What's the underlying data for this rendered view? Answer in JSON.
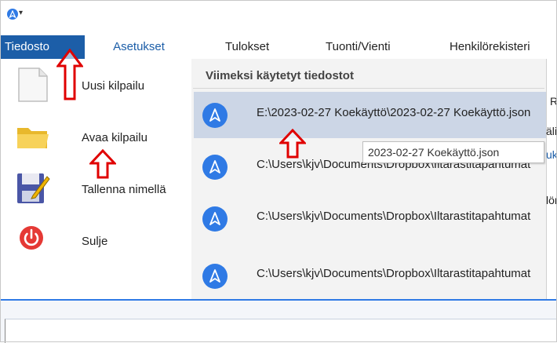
{
  "ribbon": {
    "tabs": [
      {
        "label": "Tiedosto",
        "active": true
      },
      {
        "label": "Asetukset"
      },
      {
        "label": "Tulokset"
      },
      {
        "label": "Tuonti/Vienti"
      },
      {
        "label": "Henkilörekisteri"
      }
    ]
  },
  "backstage": {
    "commands": [
      {
        "label": "Uusi kilpailu",
        "icon": "new-document-icon"
      },
      {
        "label": "Avaa kilpailu",
        "icon": "folder-icon"
      },
      {
        "label": "Tallenna nimellä",
        "icon": "save-as-icon"
      },
      {
        "label": "Sulje",
        "icon": "power-icon"
      }
    ],
    "recent": {
      "header": "Viimeksi käytetyt tiedostot",
      "items": [
        {
          "path": "E:\\2023-02-27 Koekäyttö\\2023-02-27 Koekäyttö.json",
          "selected": true
        },
        {
          "path": "C:\\Users\\kjv\\Documents\\Dropbox\\Iltarastitapahtumat"
        },
        {
          "path": "C:\\Users\\kjv\\Documents\\Dropbox\\Iltarastitapahtumat"
        },
        {
          "path": "C:\\Users\\kjv\\Documents\\Dropbox\\Iltarastitapahtumat"
        }
      ],
      "tooltip": "2023-02-27 Koekäyttö.json"
    }
  },
  "right_edge": {
    "fragments": [
      "R",
      "äli",
      "uk",
      "lör"
    ]
  },
  "colors": {
    "accent": "#1c5ea8",
    "icon_blue": "#2f7ae5",
    "annotation_red": "#e00000"
  }
}
